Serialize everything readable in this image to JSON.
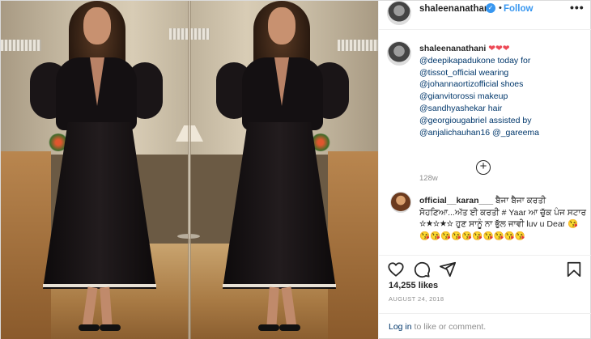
{
  "header": {
    "username": "shaleenanathani",
    "separator": "•",
    "follow_label": "Follow",
    "more_label": "•••"
  },
  "caption": {
    "username": "shaleenanathani",
    "hearts": "❤❤❤",
    "lines": [
      "@deepikapadukone today for",
      "@tissot_official wearing",
      "@johannaortizofficial shoes",
      "@gianvitorossi makeup",
      "@sandhyashekar hair",
      "@georgiougabriel assisted by",
      "@anjalichauhan16 @_gareema"
    ],
    "time": "128w"
  },
  "load_more": "+",
  "comment": {
    "username": "official__karan___",
    "text": "ਬੈਜਾ ਬੈਜਾ ਕਰਤੀ ਸੋਹਣਿਆ...ਅੱਤ ਈ ਕਰਤੀ # Yaar ਆ ਚੁੱਕ ਪੰਜ ਸਟਾਰ ☆★☆★☆ ਹੁਣ ਸਾਨੂੰ ਨਾ ਭੁੱਲ ਜਾਵੀ luv u Dear 😘😘😘😘😘😘😘😘😘😘😘"
  },
  "likes": "14,255 likes",
  "date": "AUGUST 24, 2018",
  "login": {
    "link": "Log in",
    "rest": " to like or comment."
  },
  "icons": {
    "heart": "heart-icon",
    "comment": "comment-icon",
    "share": "share-icon",
    "save": "bookmark-icon",
    "verified": "verified-badge-icon"
  },
  "colors": {
    "accent": "#3897f0",
    "hearts": "#ed4956",
    "mention": "#00376b",
    "muted": "#8e8e8e"
  }
}
